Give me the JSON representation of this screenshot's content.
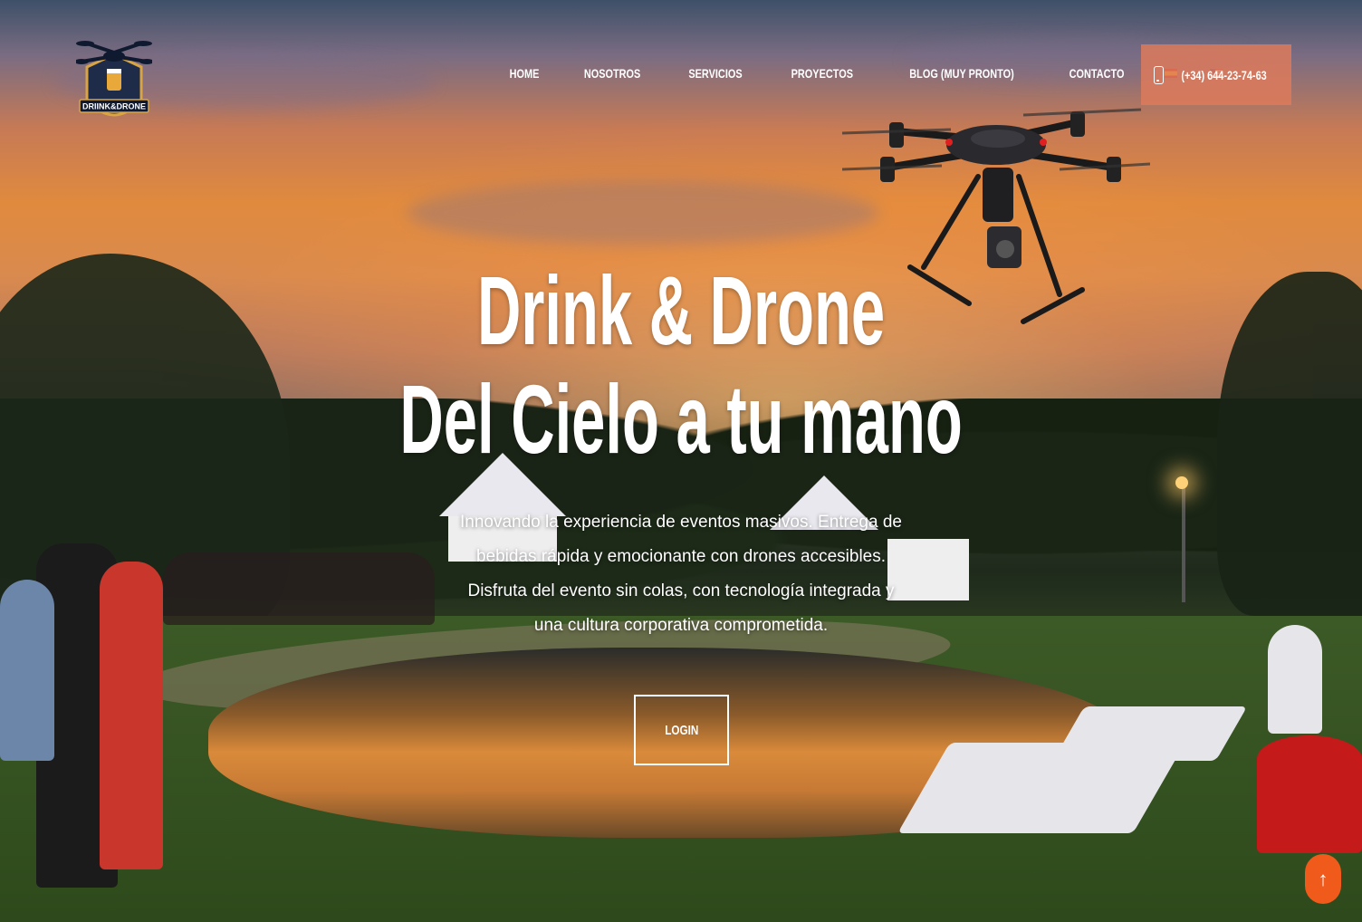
{
  "brand": {
    "logo_text": "DRIINK&DRONE"
  },
  "nav": {
    "items": [
      {
        "label": "HOME"
      },
      {
        "label": "NOSOTROS"
      },
      {
        "label": "SERVICIOS"
      },
      {
        "label": "PROYECTOS"
      },
      {
        "label": "BLOG (MUY PRONTO)"
      },
      {
        "label": "CONTACTO"
      }
    ],
    "languages": [
      {
        "icon": "spain-flag-icon"
      },
      {
        "icon": "us-flag-icon"
      }
    ]
  },
  "phone": {
    "label": "(+34) 644-23-74-63",
    "icon": "mobile-phone-icon",
    "bg_color": "#dd7a5c"
  },
  "hero": {
    "title_line1": "Drink & Drone",
    "title_line2": "Del Cielo a tu mano",
    "description": "Innovando la experiencia de eventos masivos. Entrega de bebidas rápida y emocionante con drones accesibles. Disfruta del evento sin colas, con tecnología integrada y una cultura corporativa comprometida.",
    "login_label": "LOGIN"
  },
  "scroll_top": {
    "icon": "arrow-up-icon",
    "color": "#f05a1a"
  }
}
